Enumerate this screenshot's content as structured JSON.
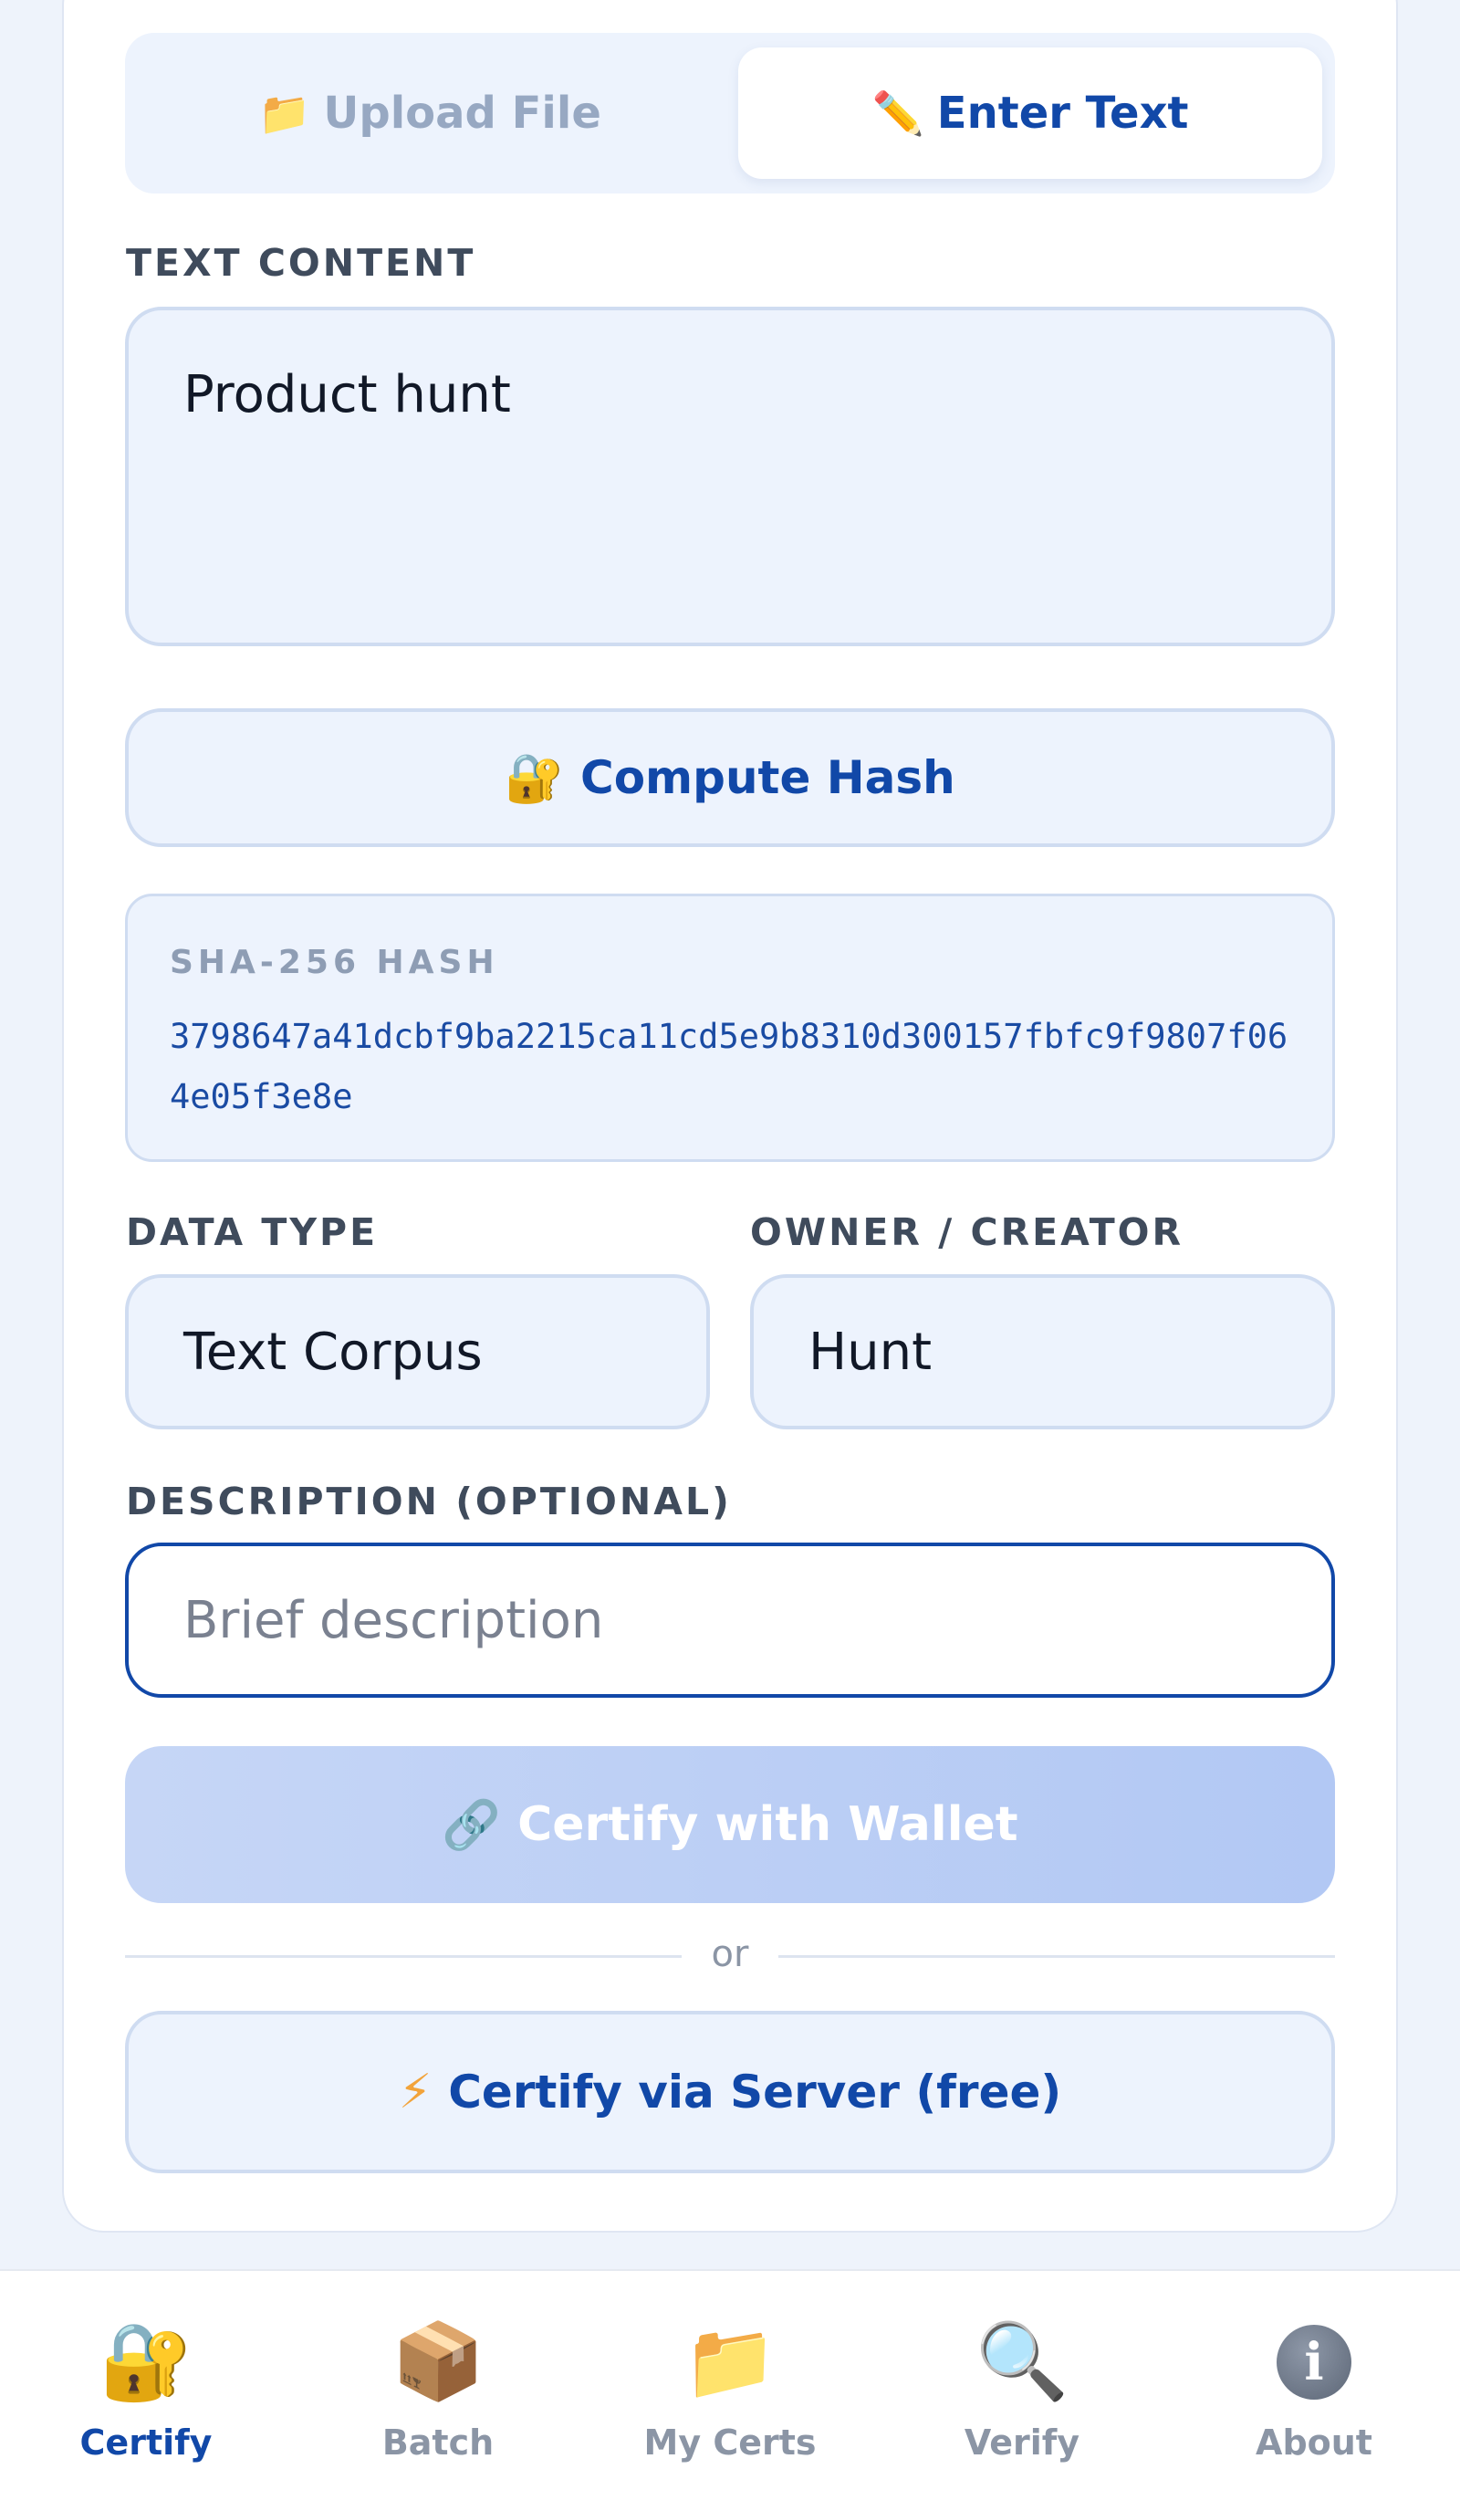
{
  "tabs": {
    "upload": {
      "icon": "📁",
      "label": "Upload File"
    },
    "enter": {
      "icon": "✏️",
      "label": "Enter Text"
    }
  },
  "text_content": {
    "label": "TEXT CONTENT",
    "value": "Product hunt"
  },
  "compute_hash": {
    "icon": "🔐",
    "label": "Compute Hash"
  },
  "hash": {
    "label": "SHA-256 HASH",
    "value": "3798647a41dcbf9ba2215ca11cd5e9b8310d300157fbfc9f9807f064e05f3e8e"
  },
  "data_type": {
    "label": "DATA TYPE",
    "value": "Text Corpus"
  },
  "owner": {
    "label": "OWNER / CREATOR",
    "value": "Hunt"
  },
  "description": {
    "label": "DESCRIPTION (OPTIONAL)",
    "placeholder": "Brief description"
  },
  "certify_wallet": {
    "icon": "🔗",
    "label": "Certify with Wallet"
  },
  "divider_text": "or",
  "certify_server": {
    "icon": "⚡",
    "label": "Certify via Server (free)"
  },
  "nav": [
    {
      "icon": "🔐",
      "label": "Certify",
      "active": true
    },
    {
      "icon": "📦",
      "label": "Batch",
      "active": false
    },
    {
      "icon": "📁",
      "label": "My Certs",
      "active": false
    },
    {
      "icon": "🔍",
      "label": "Verify",
      "active": false
    },
    {
      "icon": "i",
      "label": "About",
      "active": false
    }
  ],
  "colors": {
    "accent": "#1148a8",
    "panel": "#edf3fd",
    "border": "#cfdcf1",
    "muted": "#8b95a5"
  }
}
